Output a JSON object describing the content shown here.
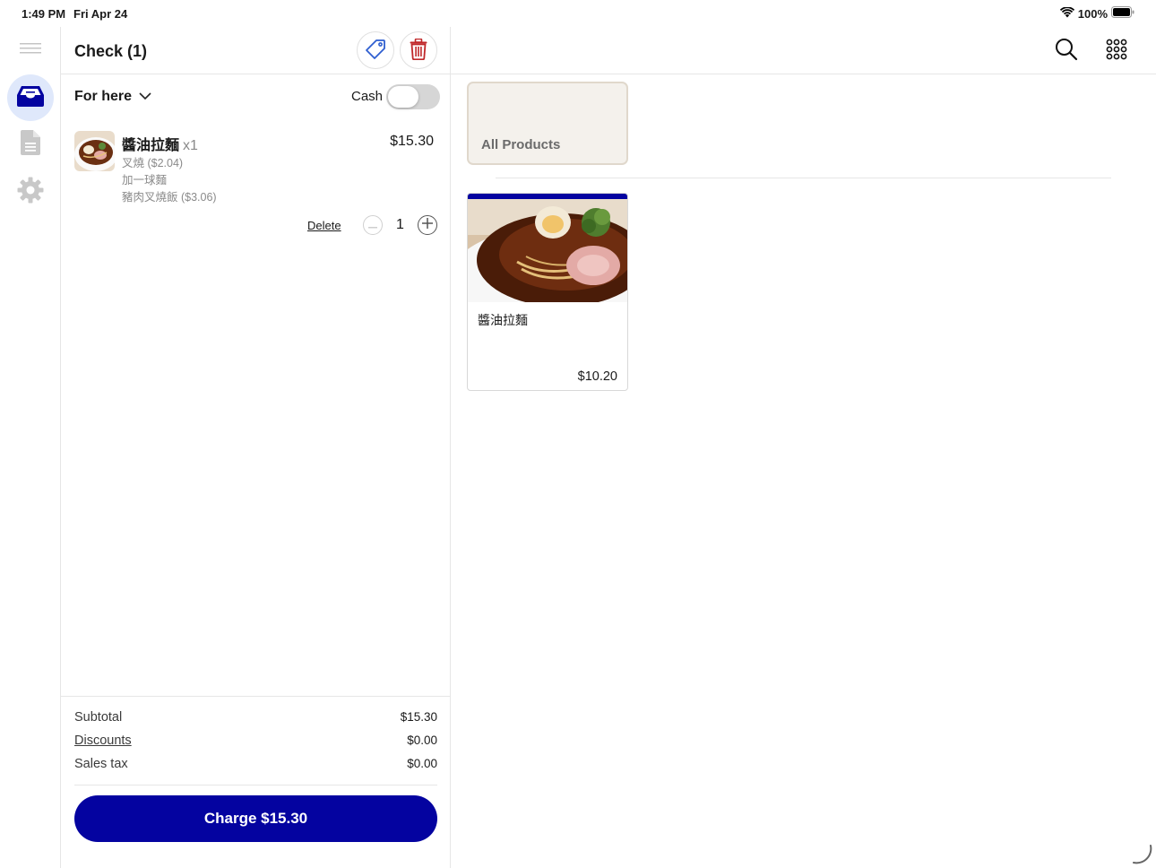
{
  "status_bar": {
    "time": "1:49 PM",
    "date": "Fri Apr 24",
    "battery": "100%"
  },
  "rail": {
    "items": [
      {
        "icon": "hamburger-menu-icon"
      },
      {
        "icon": "register-tray-icon",
        "active": true
      },
      {
        "icon": "document-icon"
      },
      {
        "icon": "gear-icon"
      }
    ]
  },
  "check": {
    "title": "Check (1)",
    "dining_option": "For here",
    "cash_label": "Cash",
    "cash_toggle_on": false,
    "line_items": [
      {
        "name": "醬油拉麵",
        "qty_label": "x1",
        "price": "$15.30",
        "modifiers": [
          "叉燒 ($2.04)",
          "加一球麵",
          "豬肉叉燒飯 ($3.06)"
        ],
        "delete_label": "Delete",
        "quantity": "1"
      }
    ],
    "totals": {
      "subtotal_label": "Subtotal",
      "subtotal_value": "$15.30",
      "discounts_label": "Discounts",
      "discounts_value": "$0.00",
      "tax_label": "Sales tax",
      "tax_value": "$0.00"
    },
    "charge_label": "Charge $15.30"
  },
  "main": {
    "categories": [
      {
        "label": "All Products"
      }
    ],
    "products": [
      {
        "name": "醬油拉麵",
        "price": "$10.20"
      }
    ]
  },
  "colors": {
    "brand_blue": "#0403a0",
    "active_rail_bg": "#dfe8fb",
    "delete_red": "#c0282a",
    "tag_blue": "#2f5fd0",
    "category_bg": "#f4f1ec"
  }
}
